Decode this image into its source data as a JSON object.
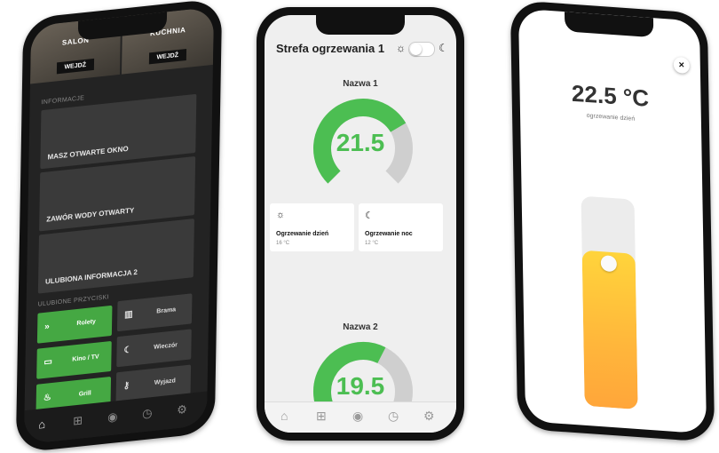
{
  "phone1": {
    "rooms": [
      {
        "label": "SALON",
        "button": "WEJDŹ"
      },
      {
        "label": "KUCHNIA",
        "button": "WEJDŹ"
      }
    ],
    "info_section": "INFORMACJE",
    "info_cards": [
      "MASZ OTWARTE OKNO",
      "ZAWÓR WODY OTWARTY",
      "ULUBIONA INFORMACJA 2"
    ],
    "fav_section": "ULUBIONE PRZYCISKI",
    "fav_buttons": [
      {
        "label": "Rolety",
        "icon": "chevrons-down-icon",
        "active": true
      },
      {
        "label": "Brama",
        "icon": "gate-icon",
        "active": false
      },
      {
        "label": "Kino / TV",
        "icon": "tv-icon",
        "active": true
      },
      {
        "label": "Wieczór",
        "icon": "moon-icon",
        "active": false
      },
      {
        "label": "Grill",
        "icon": "grill-icon",
        "active": true
      },
      {
        "label": "Wyjazd",
        "icon": "key-icon",
        "active": false
      }
    ],
    "nav": [
      "home-icon",
      "grid-icon",
      "eye-icon",
      "clock-icon",
      "settings-icon"
    ]
  },
  "phone2": {
    "title": "Strefa ogrzewania 1",
    "zones": [
      {
        "name": "Nazwa 1",
        "value": "21.5",
        "fraction": 0.72
      },
      {
        "name": "Nazwa 2",
        "value": "19.5",
        "fraction": 0.6
      }
    ],
    "modes": [
      {
        "icon": "sun-icon",
        "title": "Ogrzewanie dzień",
        "temp": "16 °C"
      },
      {
        "icon": "moon-icon",
        "title": "Ogrzewanie noc",
        "temp": "12 °C"
      }
    ],
    "colors": {
      "accent": "#4cbe52",
      "track": "#cfcfcf"
    }
  },
  "phone3": {
    "close": "×",
    "temperature": "22.5 °C",
    "mode_label": "ogrzewanie dzień",
    "slider_level": 0.74
  }
}
